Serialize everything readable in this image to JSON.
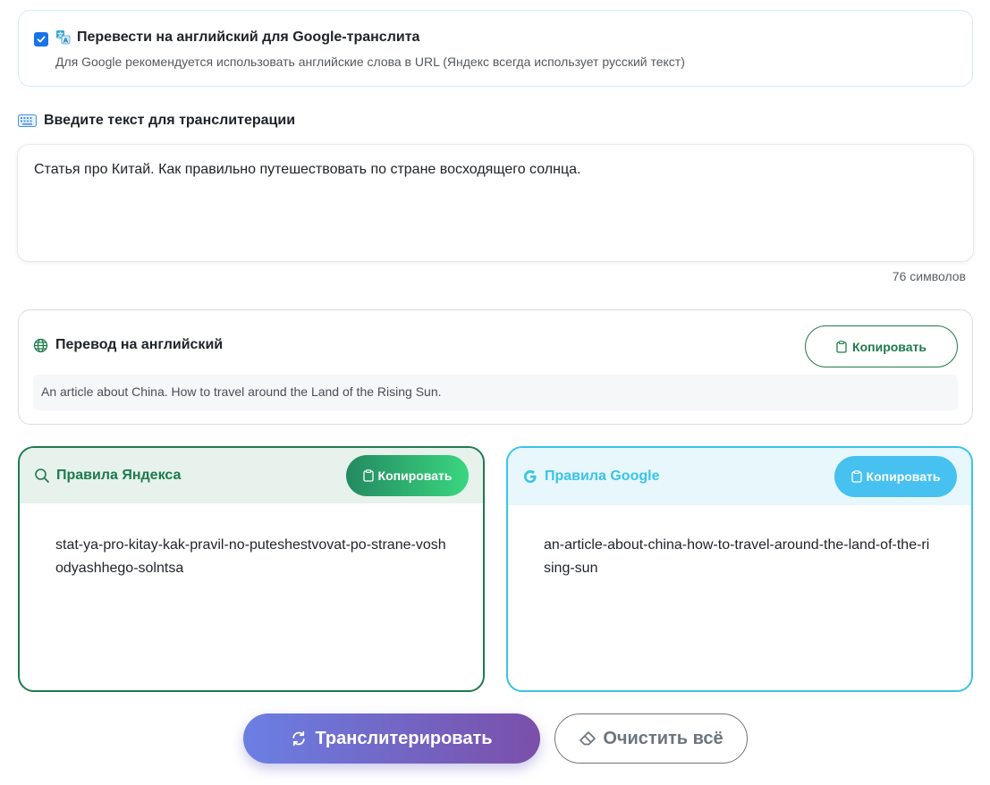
{
  "option": {
    "checked": true,
    "title": "Перевести на английский для Google-транслита",
    "description": "Для Google рекомендуется использовать английские слова в URL (Яндекс всегда использует русский текст)"
  },
  "input": {
    "title": "Введите текст для транслитерации",
    "value": "Статья про Китай. Как правильно путешествовать по стране восходящего солнца.",
    "char_count": "76 символов"
  },
  "translation": {
    "title": "Перевод на английский",
    "copy_label": "Копировать",
    "text": "An article about China. How to travel around the Land of the Rising Sun."
  },
  "yandex": {
    "title": "Правила Яндекса",
    "copy_label": "Копировать",
    "result": "stat-ya-pro-kitay-kak-pravil-no-puteshestvovat-po-strane-voshodyashhego-solntsa"
  },
  "google": {
    "title": "Правила Google",
    "copy_label": "Копировать",
    "result": "an-article-about-china-how-to-travel-around-the-land-of-the-rising-sun"
  },
  "actions": {
    "transliterate_label": "Транслитерировать",
    "clear_label": "Очистить всё"
  },
  "colors": {
    "yandex_accent": "#1e7a4c",
    "google_accent": "#39c4e6",
    "primary_gradient_start": "#6b7fe3",
    "primary_gradient_end": "#7a4fa9"
  }
}
